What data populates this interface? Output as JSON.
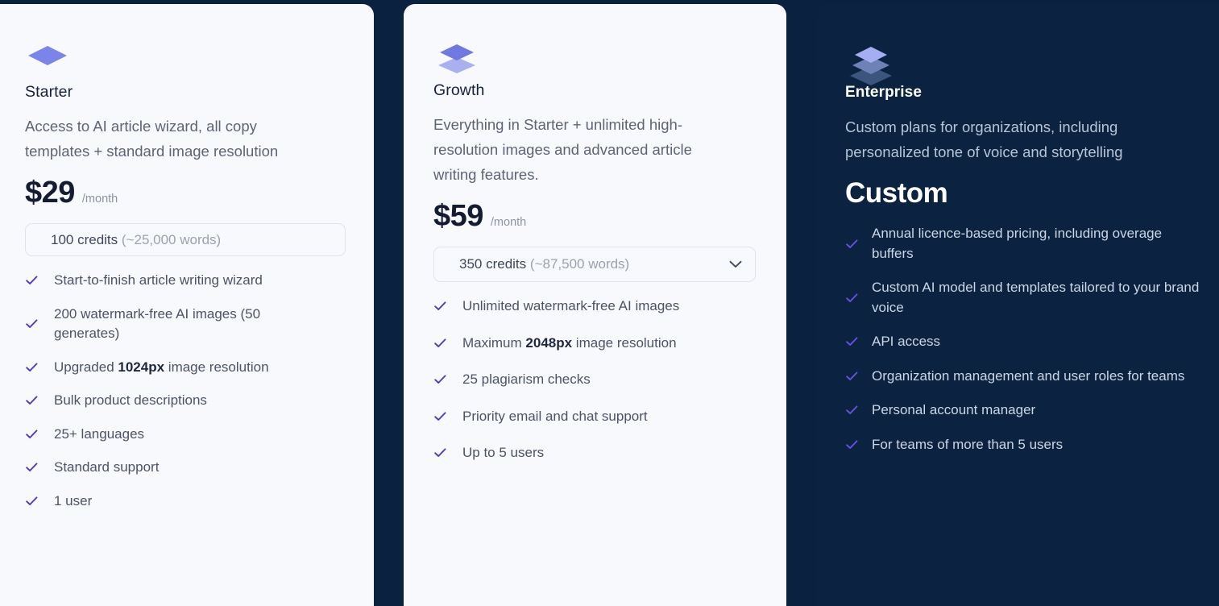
{
  "theme": {
    "page_background": "#0a2240",
    "light_card_background": "#f8f9fd",
    "dark_card_background": "#0b2241",
    "accent_check": "#4f39c4",
    "icon_violet": "#7b84e8",
    "price_color": "#131c33"
  },
  "plans": [
    {
      "id": "starter",
      "icon": "single-layer-icon",
      "name": "Starter",
      "description": "Access to AI article wizard, all copy templates + standard image resolution",
      "price": "$29",
      "period": "/month",
      "credits": {
        "amount": "100 credits",
        "words": "(~25,000 words)",
        "has_dropdown": false
      },
      "features": [
        {
          "text": "Start-to-finish article writing wizard"
        },
        {
          "text": "200 watermark-free AI images (50 generates)"
        },
        {
          "pre": "Upgraded ",
          "bold": "1024px",
          "post": " image resolution"
        },
        {
          "text": "Bulk product descriptions"
        },
        {
          "text": "25+ languages"
        },
        {
          "text": "Standard support"
        },
        {
          "text": "1 user"
        }
      ]
    },
    {
      "id": "growth",
      "icon": "double-layer-icon",
      "name": "Growth",
      "description": "Everything in Starter + unlimited high-resolution images and advanced article writing features.",
      "price": "$59",
      "period": "/month",
      "credits": {
        "amount": "350 credits",
        "words": "(~87,500 words)",
        "has_dropdown": true,
        "dropdown_icon": "chevron-down-icon"
      },
      "features": [
        {
          "text": "Unlimited watermark-free AI images"
        },
        {
          "pre": "Maximum ",
          "bold": "2048px",
          "post": " image resolution"
        },
        {
          "text": "25 plagiarism checks"
        },
        {
          "text": "Priority email and chat support"
        },
        {
          "text": "Up to 5 users"
        }
      ]
    },
    {
      "id": "enterprise",
      "icon": "triple-layer-icon",
      "name": "Enterprise",
      "description": "Custom plans for organizations, including personalized tone of voice and storytelling",
      "price": "Custom",
      "period": "",
      "credits": null,
      "features": [
        {
          "text": "Annual licence-based pricing, including overage buffers"
        },
        {
          "text": "Custom AI model and templates tailored to your brand voice"
        },
        {
          "text": "API access"
        },
        {
          "text": "Organization management and user roles for teams"
        },
        {
          "text": "Personal account manager"
        },
        {
          "text": "For teams of more than 5 users"
        }
      ]
    }
  ]
}
